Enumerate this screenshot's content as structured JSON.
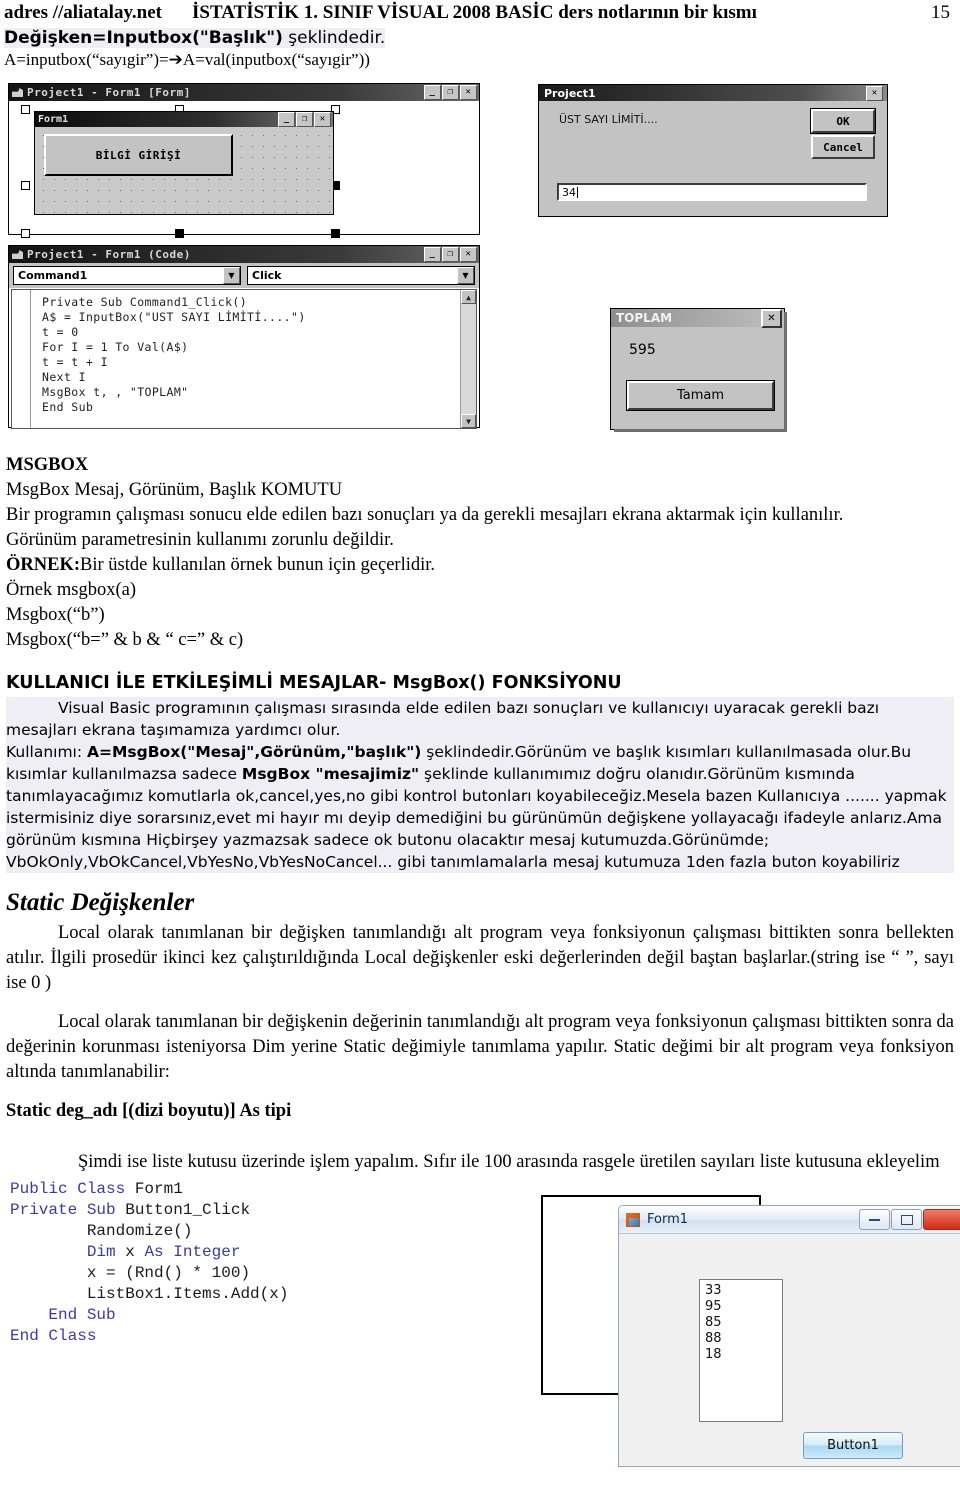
{
  "header": {
    "address": "adres //aliatalay.net",
    "title": "İSTATİSTİK 1. SINIF VİSUAL 2008 BASİC ders notlarının bir kısmı",
    "page_number": "15"
  },
  "intro": {
    "syntax_bold": "Değişken=Inputbox(\"Başlık\")",
    "syntax_rest": " şeklindedir.",
    "example_left": "A=inputbox(“sayıgir”)=",
    "arrow": "➔",
    "example_right": "A=val(inputbox(“sayıgir”))"
  },
  "vb_design": {
    "window_title": "Project1 - Form1 [Form]",
    "inner_form_title": "Form1",
    "button_label": "BİLGİ GİRİŞİ",
    "min_glyph": "_",
    "max_glyph": "❐",
    "close_glyph": "✕"
  },
  "inputbox_dialog": {
    "title": "Project1",
    "prompt": "ÜST SAYI LİMİTİ....",
    "ok_label": "OK",
    "cancel_label": "Cancel",
    "value": "34",
    "close_glyph": "✕"
  },
  "code_window": {
    "title": "Project1 - Form1 (Code)",
    "object_combo": "Command1",
    "event_combo": "Click",
    "dropdown_glyph": "▼",
    "scroll_up_glyph": "▲",
    "scroll_down_glyph": "▼",
    "code": "Private Sub Command1_Click()\nA$ = InputBox(\"UST SAYI LİMİTİ....\")\nt = 0\nFor I = 1 To Val(A$)\nt = t + I\nNext I\nMsgBox t, , \"TOPLAM\"\nEnd Sub"
  },
  "toplam_msgbox": {
    "title": "TOPLAM",
    "value": "595",
    "ok_label": "Tamam",
    "close_glyph": "✕"
  },
  "msgbox_section": {
    "heading": "MSGBOX",
    "line1": "MsgBox Mesaj, Görünüm, Başlık KOMUTU",
    "line2": "Bir programın çalışması sonucu elde edilen bazı sonuçları ya da gerekli mesajları ekrana aktarmak için kullanılır.",
    "line3": "Görünüm parametresinin kullanımı zorunlu değildir.",
    "ornek_bold": "ÖRNEK:",
    "ornek_rest": "Bir üstde kullanılan örnek bunun için geçerlidir.",
    "line4": "Örnek msgbox(a)",
    "line5": "Msgbox(“b”)",
    "line6": "Msgbox(“b=” & b & “  c=” & c)"
  },
  "msgbox_fn_section": {
    "heading": "KULLANICI İLE ETKİLEŞİMLİ MESAJLAR- MsgBox() FONKSİYONU",
    "para1": "Visual Basic programının çalışması sırasında elde edilen bazı sonuçları ve kullanıcıyı uyaracak gerekli bazı mesajları ekrana taşımamıza yardımcı olur.",
    "usage_prefix": "Kullanımı: ",
    "usage_bold": "A=MsgBox(\"Mesaj\",Görünüm,\"başlık\")",
    "usage_mid": " şeklindedir.Görünüm ve başlık kısımları kullanılmasada olur.Bu kısımlar kullanılmazsa sadece ",
    "usage_bold2": "MsgBox \"mesajimiz\"",
    "usage_rest": " şeklinde kullanımımız doğru olanıdır.Görünüm kısmında tanımlayacağımız komutlarla ok,cancel,yes,no gibi kontrol butonları koyabileceğiz.Mesela bazen Kullanıcıya ....... yapmak istermisiniz diye sorarsınız,evet mi hayır mı deyip demediğini bu gürünümün değişkene yollayacağı ifadeyle anlarız.Ama görünüm kısmına Hiçbirşey yazmazsak sadece ok butonu olacaktır mesaj kutumuzda.Görünümde; VbOkOnly,VbOkCancel,VbYesNo,VbYesNoCancel... gibi tanımlamalarla mesaj kutumuza 1den fazla buton koyabiliriz"
  },
  "static_section": {
    "heading": "Static Değişkenler",
    "para1": "Local olarak tanımlanan bir değişken tanımlandığı alt program veya fonksiyonun çalışması bittikten sonra bellekten atılır. İlgili prosedür ikinci kez çalıştırıldığında Local değişkenler eski değerlerinden değil baştan başlarlar.(string ise “ ”, sayı ise 0 )",
    "para2": "Local olarak tanımlanan bir değişkenin değerinin tanımlandığı alt program veya fonksiyonun çalışması bittikten sonra da değerinin korunması isteniyorsa Dim yerine Static değimiyle tanımlama yapılır. Static değimi bir alt program veya fonksiyon altında tanımlanabilir:",
    "syntax": "Static deg_adı [(dizi boyutu)] As tipi",
    "para3": "Şimdi ise liste kutusu üzerinde işlem yapalım.  Sıfır ile 100 arasında rasgele üretilen sayıları liste kutusuna ekleyelim"
  },
  "vbnet_code": {
    "l1_kw": "Public Class",
    "l1_rest": " Form1",
    "l2_kw": "Private Sub",
    "l2_rest": " Button1_Click",
    "l3": "Randomize()",
    "l4_kw": "Dim",
    "l4_mid": " x ",
    "l4_kw2": "As Integer",
    "l5": "x = (Rnd() * 100)",
    "l6": "ListBox1.Items.Add(x)",
    "l7_kw": "End Sub",
    "l8_kw": "End Class"
  },
  "net_form": {
    "title": "Form1",
    "listbox_items": [
      "33",
      "95",
      "85",
      "88",
      "18"
    ],
    "button_label": "Button1"
  }
}
